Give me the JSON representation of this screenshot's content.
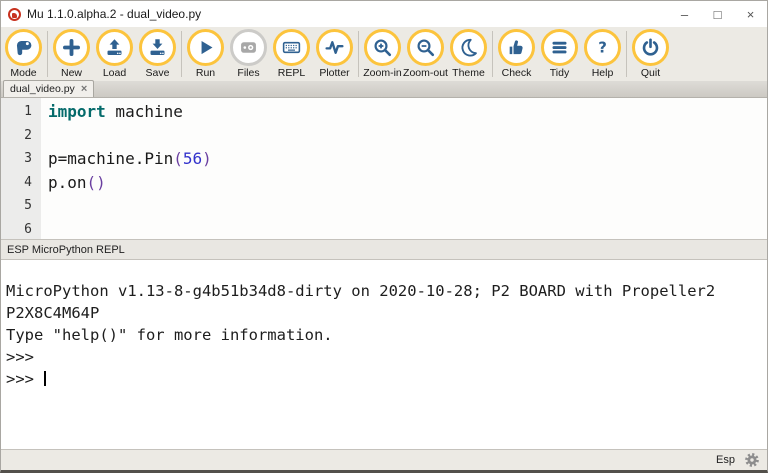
{
  "window": {
    "app_title": "Mu 1.1.0.alpha.2 - dual_video.py",
    "controls": {
      "minimize": "–",
      "maximize": "□",
      "close": "×"
    }
  },
  "toolbar": {
    "buttons": [
      {
        "id": "mode",
        "label": "Mode",
        "enabled": true
      },
      {
        "id": "new",
        "label": "New",
        "enabled": true
      },
      {
        "id": "load",
        "label": "Load",
        "enabled": true
      },
      {
        "id": "save",
        "label": "Save",
        "enabled": true
      },
      {
        "id": "run",
        "label": "Run",
        "enabled": true
      },
      {
        "id": "files",
        "label": "Files",
        "enabled": false
      },
      {
        "id": "repl",
        "label": "REPL",
        "enabled": true
      },
      {
        "id": "plotter",
        "label": "Plotter",
        "enabled": true
      },
      {
        "id": "zoom-in",
        "label": "Zoom-in",
        "enabled": true
      },
      {
        "id": "zoom-out",
        "label": "Zoom-out",
        "enabled": true
      },
      {
        "id": "theme",
        "label": "Theme",
        "enabled": true
      },
      {
        "id": "check",
        "label": "Check",
        "enabled": true
      },
      {
        "id": "tidy",
        "label": "Tidy",
        "enabled": true
      },
      {
        "id": "help",
        "label": "Help",
        "enabled": true
      },
      {
        "id": "quit",
        "label": "Quit",
        "enabled": true
      }
    ]
  },
  "tabs": [
    {
      "label": "dual_video.py",
      "close_glyph": "×",
      "active": true
    }
  ],
  "editor": {
    "line_numbers": [
      1,
      2,
      3,
      4,
      5,
      6
    ],
    "lines": [
      [
        {
          "t": "import",
          "c": "kw"
        },
        {
          "t": " machine",
          "c": "pl"
        }
      ],
      [],
      [
        {
          "t": "p=machine.Pin",
          "c": "pl"
        },
        {
          "t": "(",
          "c": "br"
        },
        {
          "t": "56",
          "c": "num"
        },
        {
          "t": ")",
          "c": "br"
        }
      ],
      [
        {
          "t": "p.on",
          "c": "pl"
        },
        {
          "t": "()",
          "c": "br"
        }
      ],
      [],
      []
    ]
  },
  "repl": {
    "header": "ESP MicroPython REPL",
    "lines": [
      "MicroPython v1.13-8-g4b51b34d8-dirty on 2020-10-28; P2 BOARD with Propeller2",
      "P2X8C4M64P",
      "Type \"help()\" for more information.",
      ">>> ",
      ">>> "
    ],
    "cursor_line": 4
  },
  "statusbar": {
    "mode_label": "Esp"
  },
  "colors": {
    "accent_gold": "#fcc43d",
    "icon_blue": "#2f6191",
    "disabled_gray": "#a8a8a8",
    "keyword_teal": "#056b6b",
    "number_blue": "#3333cc",
    "bracket_purple": "#6a3fa0",
    "toolbar_bg": "#eceae4"
  }
}
